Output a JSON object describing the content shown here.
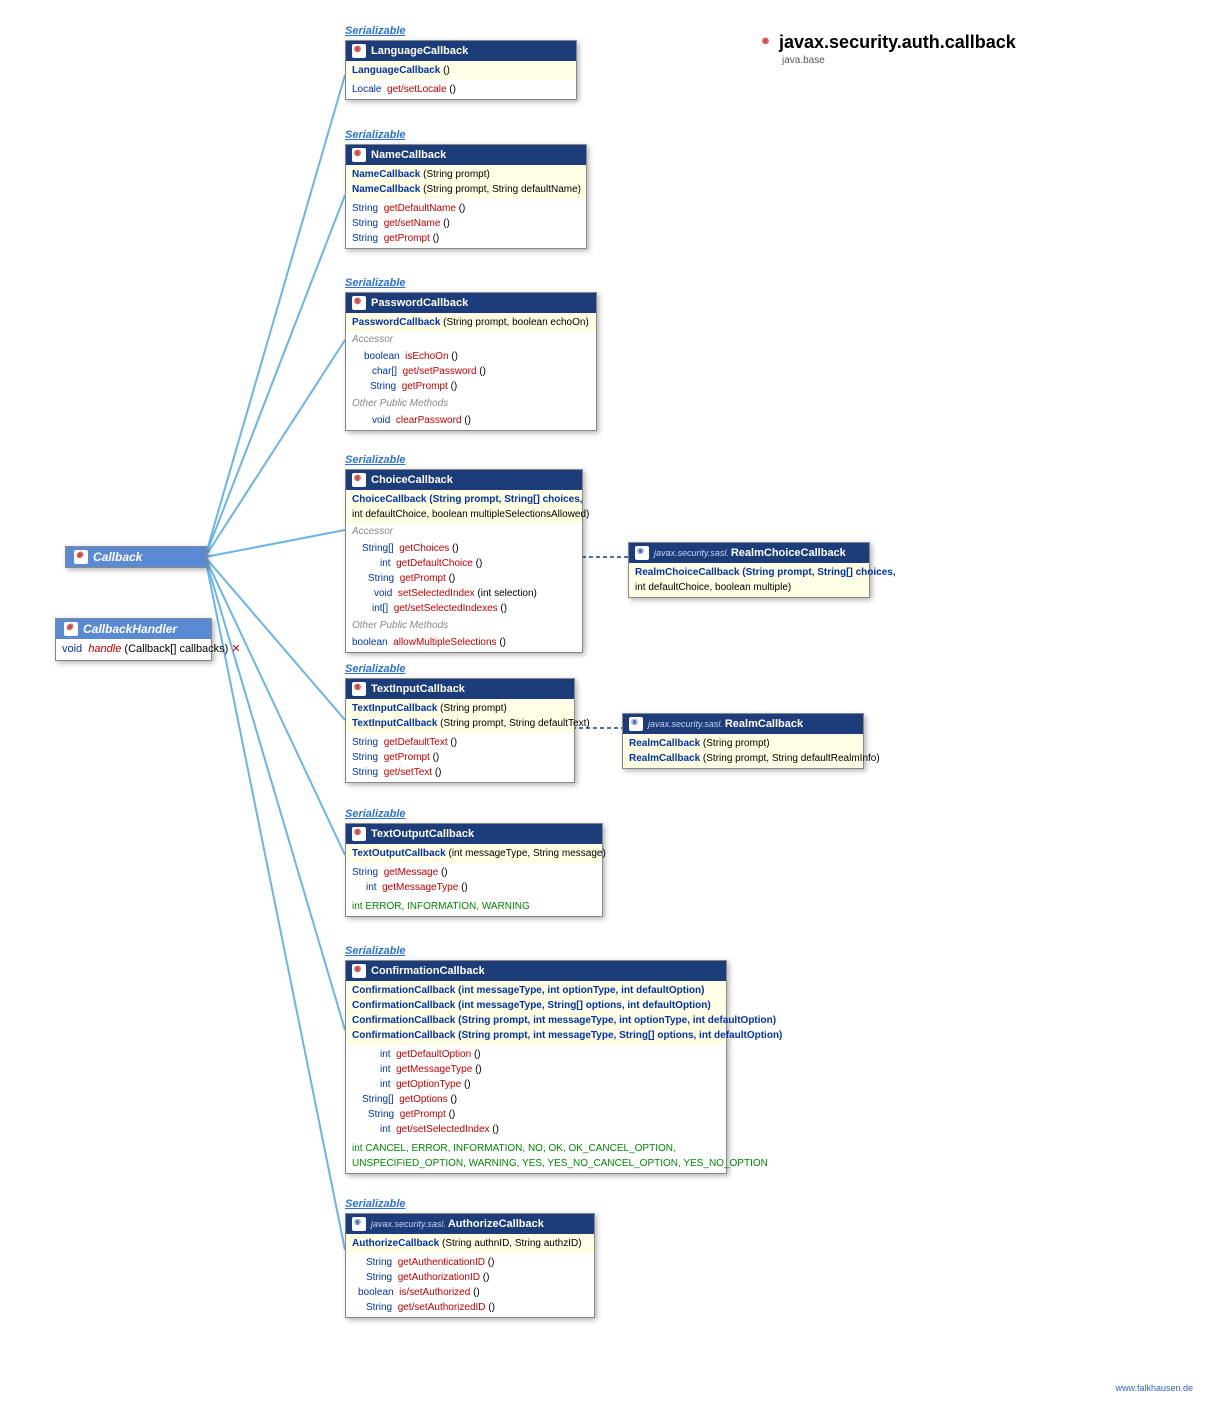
{
  "package": {
    "name": "javax.security.auth.callback",
    "module": "java.base"
  },
  "serializable": "Serializable",
  "callback": {
    "name": "Callback"
  },
  "handler": {
    "name": "CallbackHandler",
    "row": {
      "ret": "void",
      "m": "handle",
      "p": "(Callback[] callbacks)",
      "throws": " ✕"
    }
  },
  "classes": {
    "language": {
      "name": "LanguageCallback",
      "ctors": [
        {
          "name": "LanguageCallback",
          "p": " ()"
        }
      ],
      "rows": [
        {
          "ret": "Locale",
          "m": "get/setLocale",
          "p": " ()"
        }
      ]
    },
    "name": {
      "name": "NameCallback",
      "ctors": [
        {
          "name": "NameCallback",
          "p": " (String prompt)"
        },
        {
          "name": "NameCallback",
          "p": " (String prompt, String defaultName)"
        }
      ],
      "rows": [
        {
          "ret": "String",
          "m": "getDefaultName",
          "p": " ()"
        },
        {
          "ret": "String",
          "m": "get/setName",
          "p": " ()"
        },
        {
          "ret": "String",
          "m": "getPrompt",
          "p": " ()"
        }
      ]
    },
    "password": {
      "name": "PasswordCallback",
      "ctors": [
        {
          "name": "PasswordCallback",
          "p": " (String prompt, boolean echoOn)"
        }
      ],
      "accessor_label": "Accessor",
      "accessors": [
        {
          "ret": "boolean",
          "m": "isEchoOn",
          "p": " ()"
        },
        {
          "ret": "char[]",
          "m": "get/setPassword",
          "p": " ()"
        },
        {
          "ret": "String",
          "m": "getPrompt",
          "p": " ()"
        }
      ],
      "other_label": "Other Public Methods",
      "others": [
        {
          "ret": "void",
          "m": "clearPassword",
          "p": " ()"
        }
      ]
    },
    "choice": {
      "name": "ChoiceCallback",
      "ctor_l1": "ChoiceCallback (String prompt, String[] choices,",
      "ctor_l2": "        int defaultChoice, boolean multipleSelectionsAllowed)",
      "accessor_label": "Accessor",
      "accessors": [
        {
          "ret": "String[]",
          "m": "getChoices",
          "p": " ()"
        },
        {
          "ret": "int",
          "m": "getDefaultChoice",
          "p": " ()"
        },
        {
          "ret": "String",
          "m": "getPrompt",
          "p": " ()"
        },
        {
          "ret": "void",
          "m": "setSelectedIndex",
          "p": " (int selection)"
        },
        {
          "ret": "int[]",
          "m": "get/setSelectedIndexes",
          "p": " ()"
        }
      ],
      "other_label": "Other Public Methods",
      "others": [
        {
          "ret": "boolean",
          "m": "allowMultipleSelections",
          "p": " ()"
        }
      ]
    },
    "textin": {
      "name": "TextInputCallback",
      "ctors": [
        {
          "name": "TextInputCallback",
          "p": " (String prompt)"
        },
        {
          "name": "TextInputCallback",
          "p": " (String prompt, String defaultText)"
        }
      ],
      "rows": [
        {
          "ret": "String",
          "m": "getDefaultText",
          "p": " ()"
        },
        {
          "ret": "String",
          "m": "getPrompt",
          "p": " ()"
        },
        {
          "ret": "String",
          "m": "get/setText",
          "p": " ()"
        }
      ]
    },
    "textout": {
      "name": "TextOutputCallback",
      "ctors": [
        {
          "name": "TextOutputCallback",
          "p": " (int messageType, String message)"
        }
      ],
      "rows": [
        {
          "ret": "String",
          "m": "getMessage",
          "p": " ()"
        },
        {
          "ret": "int",
          "m": "getMessageType",
          "p": " ()"
        }
      ],
      "consts": "int ERROR, INFORMATION, WARNING"
    },
    "confirm": {
      "name": "ConfirmationCallback",
      "ctors": [
        "ConfirmationCallback (int messageType, int optionType, int defaultOption)",
        "ConfirmationCallback (int messageType, String[] options, int defaultOption)",
        "ConfirmationCallback (String prompt, int messageType, int optionType, int defaultOption)",
        "ConfirmationCallback (String prompt, int messageType, String[] options, int defaultOption)"
      ],
      "rows": [
        {
          "ret": "int",
          "m": "getDefaultOption",
          "p": " ()"
        },
        {
          "ret": "int",
          "m": "getMessageType",
          "p": " ()"
        },
        {
          "ret": "int",
          "m": "getOptionType",
          "p": " ()"
        },
        {
          "ret": "String[]",
          "m": "getOptions",
          "p": " ()"
        },
        {
          "ret": "String",
          "m": "getPrompt",
          "p": " ()"
        },
        {
          "ret": "int",
          "m": "get/setSelectedIndex",
          "p": " ()"
        }
      ],
      "consts1": "int CANCEL, ERROR, INFORMATION, NO, OK, OK_CANCEL_OPTION,",
      "consts2": "    UNSPECIFIED_OPTION, WARNING, YES, YES_NO_CANCEL_OPTION, YES_NO_OPTION"
    },
    "authorize": {
      "pkg": "javax.security.sasl.",
      "name": "AuthorizeCallback",
      "ctors": [
        {
          "name": "AuthorizeCallback",
          "p": " (String authnID, String authzID)"
        }
      ],
      "rows": [
        {
          "ret": "String",
          "m": "getAuthenticationID",
          "p": " ()"
        },
        {
          "ret": "String",
          "m": "getAuthorizationID",
          "p": " ()"
        },
        {
          "ret": "boolean",
          "m": "is/setAuthorized",
          "p": " ()"
        },
        {
          "ret": "String",
          "m": "get/setAuthorizedID",
          "p": " ()"
        }
      ]
    },
    "realmchoice": {
      "pkg": "javax.security.sasl.",
      "name": "RealmChoiceCallback",
      "ctor_l1": "RealmChoiceCallback (String prompt, String[] choices,",
      "ctor_l2": "        int defaultChoice, boolean multiple)"
    },
    "realm": {
      "pkg": "javax.security.sasl.",
      "name": "RealmCallback",
      "ctors": [
        {
          "name": "RealmCallback",
          "p": " (String prompt)"
        },
        {
          "name": "RealmCallback",
          "p": " (String prompt, String defaultRealmInfo)"
        }
      ]
    }
  },
  "footer": "www.falkhausen.de"
}
